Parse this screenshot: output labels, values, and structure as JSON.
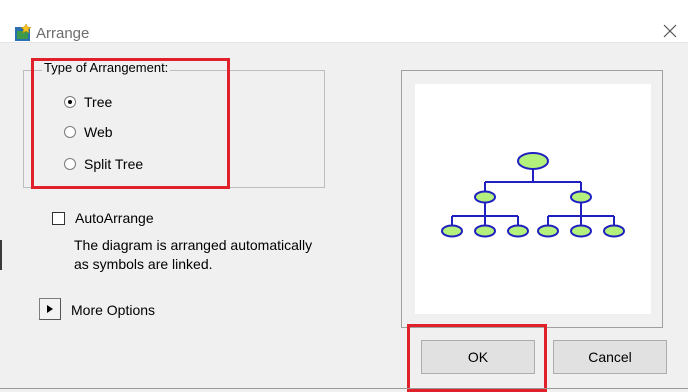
{
  "window": {
    "title": "Arrange",
    "close_icon": "close-icon",
    "app_icon": "arrange-app-icon"
  },
  "arrangement": {
    "group_label": "Type of Arrangement:",
    "options": [
      {
        "label": "Tree",
        "selected": true
      },
      {
        "label": "Web",
        "selected": false
      },
      {
        "label": "Split Tree",
        "selected": false
      }
    ]
  },
  "auto_arrange": {
    "label": "AutoArrange",
    "checked": false,
    "description_line1": "The diagram is arranged automatically",
    "description_line2": "as symbols are linked."
  },
  "more_options": {
    "label": "More Options",
    "icon": "play-arrow-icon"
  },
  "preview": {
    "type": "tree",
    "node_fill": "#b4f07c",
    "line_color": "#2020c0"
  },
  "buttons": {
    "ok_label": "OK",
    "cancel_label": "Cancel"
  },
  "colors": {
    "highlight": "#e0202a"
  }
}
